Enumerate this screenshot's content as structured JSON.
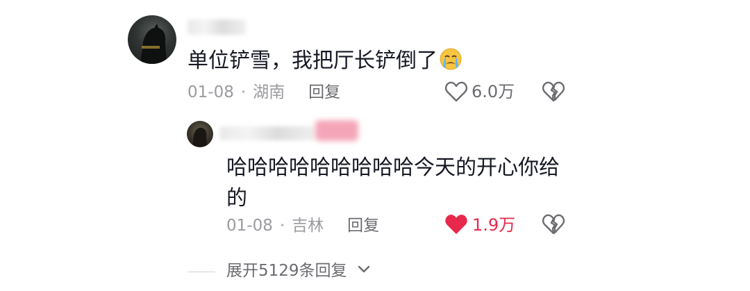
{
  "comment": {
    "username": "",
    "text": "单位铲雪，我把厅长铲倒了",
    "emoji_icon": "crying-face-icon",
    "date": "01-08",
    "separator": "·",
    "location": "湖南",
    "reply_label": "回复",
    "like_count": "6.0万",
    "liked": false
  },
  "reply": {
    "username": "",
    "text": "哈哈哈哈哈哈哈哈哈今天的开心你给\n的",
    "date": "01-08",
    "separator": "·",
    "location": "吉林",
    "reply_label": "回复",
    "like_count": "1.9万",
    "liked": true
  },
  "expand": {
    "label": "展开5129条回复"
  },
  "colors": {
    "liked": "#e6284d",
    "meta": "#9a9a9f",
    "text": "#161823"
  }
}
